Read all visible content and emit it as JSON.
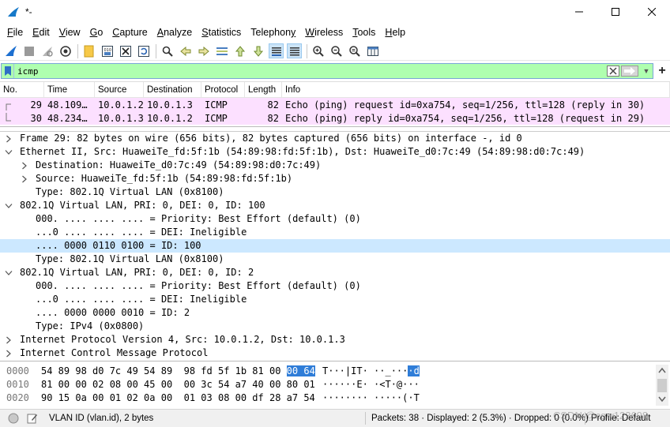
{
  "window": {
    "title": "*-",
    "controls": [
      "minimize-icon",
      "maximize-icon",
      "close-icon"
    ]
  },
  "menu": [
    "File",
    "Edit",
    "View",
    "Go",
    "Capture",
    "Analyze",
    "Statistics",
    "Telephony",
    "Wireless",
    "Tools",
    "Help"
  ],
  "menu_mnemonics": [
    "F",
    "E",
    "V",
    "G",
    "C",
    "A",
    "S",
    "y",
    "W",
    "T",
    "H"
  ],
  "toolbar": [
    "shark-fin-start-icon",
    "stop-icon",
    "restart-icon",
    "options-icon",
    "open-file-icon",
    "save-file-icon",
    "close-file-icon",
    "reload-icon",
    "find-icon",
    "go-back-icon",
    "go-forward-icon",
    "go-to-packet-icon",
    "go-first-icon",
    "go-last-icon",
    "auto-scroll-icon",
    "colorize-icon",
    "zoom-in-icon",
    "zoom-out-icon",
    "zoom-normal-icon",
    "resize-columns-icon"
  ],
  "filter": {
    "value": "icmp",
    "plus": "+"
  },
  "packet_list": {
    "columns": [
      "No.",
      "Time",
      "Source",
      "Destination",
      "Protocol",
      "Length",
      "Info"
    ],
    "rows": [
      [
        "29",
        "48.109…",
        "10.0.1.2",
        "10.0.1.3",
        "ICMP",
        "82",
        "Echo (ping) request  id=0xa754, seq=1/256, ttl=128 (reply in 30)"
      ],
      [
        "30",
        "48.234…",
        "10.0.1.3",
        "10.0.1.2",
        "ICMP",
        "82",
        "Echo (ping) reply    id=0xa754, seq=1/256, ttl=128 (request in 29)"
      ]
    ],
    "row_color": "#fce0ff"
  },
  "details": [
    {
      "level": 0,
      "expander": "collapsed",
      "text": "Frame 29: 82 bytes on wire (656 bits), 82 bytes captured (656 bits) on interface -, id 0"
    },
    {
      "level": 0,
      "expander": "expanded",
      "text": "Ethernet II, Src: HuaweiTe_fd:5f:1b (54:89:98:fd:5f:1b), Dst: HuaweiTe_d0:7c:49 (54:89:98:d0:7c:49)"
    },
    {
      "level": 1,
      "expander": "collapsed",
      "text": "Destination: HuaweiTe_d0:7c:49 (54:89:98:d0:7c:49)"
    },
    {
      "level": 1,
      "expander": "collapsed",
      "text": "Source: HuaweiTe_fd:5f:1b (54:89:98:fd:5f:1b)"
    },
    {
      "level": 1,
      "expander": "none",
      "text": "Type: 802.1Q Virtual LAN (0x8100)"
    },
    {
      "level": 0,
      "expander": "expanded",
      "text": "802.1Q Virtual LAN, PRI: 0, DEI: 0, ID: 100"
    },
    {
      "level": 1,
      "expander": "none",
      "text": "000. .... .... .... = Priority: Best Effort (default) (0)"
    },
    {
      "level": 1,
      "expander": "none",
      "text": "...0 .... .... .... = DEI: Ineligible"
    },
    {
      "level": 1,
      "expander": "none",
      "text": ".... 0000 0110 0100 = ID: 100",
      "selected": true
    },
    {
      "level": 1,
      "expander": "none",
      "text": "Type: 802.1Q Virtual LAN (0x8100)"
    },
    {
      "level": 0,
      "expander": "expanded",
      "text": "802.1Q Virtual LAN, PRI: 0, DEI: 0, ID: 2"
    },
    {
      "level": 1,
      "expander": "none",
      "text": "000. .... .... .... = Priority: Best Effort (default) (0)"
    },
    {
      "level": 1,
      "expander": "none",
      "text": "...0 .... .... .... = DEI: Ineligible"
    },
    {
      "level": 1,
      "expander": "none",
      "text": ".... 0000 0000 0010 = ID: 2"
    },
    {
      "level": 1,
      "expander": "none",
      "text": "Type: IPv4 (0x0800)"
    },
    {
      "level": 0,
      "expander": "collapsed",
      "text": "Internet Protocol Version 4, Src: 10.0.1.2, Dst: 10.0.1.3"
    },
    {
      "level": 0,
      "expander": "collapsed",
      "text": "Internet Control Message Protocol"
    }
  ],
  "hex": [
    {
      "offset": "0000",
      "bytes_pre": "54 89 98 d0 7c 49 54 89  98 fd 5f 1b 81 00 ",
      "bytes_hl": "00 64",
      "bytes_post": "",
      "ascii_pre": "T···|IT· ··_···",
      "ascii_hl": "·d"
    },
    {
      "offset": "0010",
      "bytes_pre": "81 00 00 02 08 00 45 00  00 3c 54 a7 40 00 80 01",
      "bytes_hl": "",
      "bytes_post": "",
      "ascii_pre": "······E· ·<T·@···",
      "ascii_hl": ""
    },
    {
      "offset": "0020",
      "bytes_pre": "90 15 0a 00 01 02 0a 00  01 03 08 00 df 28 a7 54",
      "bytes_hl": "",
      "bytes_post": "",
      "ascii_pre": "········ ·····(·T",
      "ascii_hl": ""
    }
  ],
  "status": {
    "field": "VLAN ID (vlan.id), 2 bytes",
    "packets": "Packets: 38 · Displayed: 2 (5.3%) · Dropped: 0 (0.0%)",
    "profile": "Profile: Default",
    "watermark": "CSDN @cgw123698"
  },
  "colors": {
    "filter_valid": "#afffaf",
    "row_highlight": "#fce0ff",
    "detail_selected": "#cce8ff",
    "hex_selected": "#2f7dd8"
  }
}
